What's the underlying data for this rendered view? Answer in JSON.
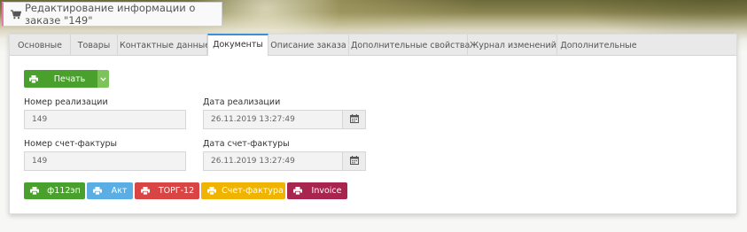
{
  "page": {
    "title": "Редактирование информации о заказе \"149\"",
    "title_icon": "shopping-cart-icon"
  },
  "tabs": [
    {
      "label": "Основные",
      "active": false
    },
    {
      "label": "Товары",
      "active": false
    },
    {
      "label": "Контактные данные",
      "active": false
    },
    {
      "label": "Документы",
      "active": true
    },
    {
      "label": "Описание заказа",
      "active": false
    },
    {
      "label": "Дополнительные свойства",
      "active": false
    },
    {
      "label": "Журнал изменений",
      "active": false
    },
    {
      "label": "Дополнительные",
      "active": false
    }
  ],
  "print": {
    "label": "Печать",
    "icon": "printer-icon",
    "dropdown_icon": "chevron-down-icon",
    "color": "#4aa02c",
    "caret_color": "#7cc35a"
  },
  "fields": {
    "realization_number": {
      "label": "Номер реализации",
      "value": "149"
    },
    "realization_date": {
      "label": "Дата реализации",
      "value": "26.11.2019 13:27:49",
      "icon": "calendar-icon"
    },
    "invoice_number": {
      "label": "Номер счет-фактуры",
      "value": "149"
    },
    "invoice_date": {
      "label": "Дата счет-фактуры",
      "value": "26.11.2019 13:27:49",
      "icon": "calendar-icon"
    }
  },
  "document_buttons": [
    {
      "label": "ф112эп",
      "color": "#4aa02c",
      "icon": "printer-icon"
    },
    {
      "label": "Акт",
      "color": "#5aaee3",
      "icon": "printer-icon"
    },
    {
      "label": "ТОРГ-12",
      "color": "#d94545",
      "icon": "printer-icon"
    },
    {
      "label": "Счет-фактура",
      "color": "#f0b400",
      "icon": "printer-icon"
    },
    {
      "label": "Invoice",
      "color": "#a8264e",
      "icon": "printer-icon"
    }
  ],
  "colors": {
    "active_tab_accent": "#3b8fd8",
    "title_accent": "#e87aa3"
  }
}
